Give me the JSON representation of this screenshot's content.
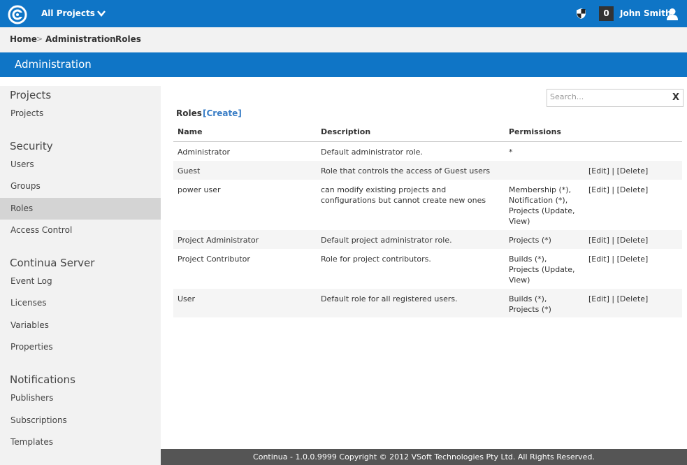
{
  "topbar": {
    "project_selector": "All Projects",
    "notification_count": "0",
    "user_name": "John Smith"
  },
  "breadcrumb": [
    "Home",
    "Administration",
    "Roles"
  ],
  "admin_title": "Administration",
  "sidebar": {
    "sections": [
      {
        "title": "Projects",
        "items": [
          "Projects"
        ]
      },
      {
        "title": "Security",
        "items": [
          "Users",
          "Groups",
          "Roles",
          "Access Control"
        ]
      },
      {
        "title": "Continua Server",
        "items": [
          "Event Log",
          "Licenses",
          "Variables",
          "Properties"
        ]
      },
      {
        "title": "Notifications",
        "items": [
          "Publishers",
          "Subscriptions",
          "Templates"
        ]
      }
    ],
    "active": "Roles"
  },
  "search": {
    "placeholder": "Search...",
    "clear": "X"
  },
  "roles": {
    "title": "Roles",
    "create_link": "[Create]",
    "columns": [
      "Name",
      "Description",
      "Permissions"
    ],
    "rows": [
      {
        "name": "Administrator",
        "description": "Default administrator role.",
        "permissions": [
          "*"
        ],
        "edit": "",
        "sep": "",
        "delete": ""
      },
      {
        "name": "Guest",
        "description": "Role that controls the access of Guest users",
        "permissions": [],
        "edit": "[Edit]",
        "sep": "|",
        "delete": "[Delete]"
      },
      {
        "name": "power user",
        "description": [
          "can modify existing projects and",
          "configurations but cannot create new ones"
        ],
        "permissions": [
          "Membership (*),",
          "Notification (*),",
          "Projects (Update,",
          "View)"
        ],
        "edit": "[Edit]",
        "sep": "|",
        "delete": "[Delete]"
      },
      {
        "name": "Project Administrator",
        "description": "Default project administrator role.",
        "permissions": [
          "Projects (*)"
        ],
        "edit": "[Edit]",
        "sep": "|",
        "delete": "[Delete]"
      },
      {
        "name": "Project Contributor",
        "description": "Role for project contributors.",
        "permissions": [
          "Builds (*),",
          "Projects (Update,",
          "View)"
        ],
        "edit": "[Edit]",
        "sep": "|",
        "delete": "[Delete]"
      },
      {
        "name": "User",
        "description": "Default role for all registered users.",
        "permissions": [
          "Builds (*),",
          "Projects (*)"
        ],
        "edit": "[Edit]",
        "sep": "|",
        "delete": "[Delete]"
      }
    ]
  },
  "footer": "Continua - 1.0.0.9999 Copyright © 2012 VSoft Technologies Pty Ltd. All Rights Reserved."
}
